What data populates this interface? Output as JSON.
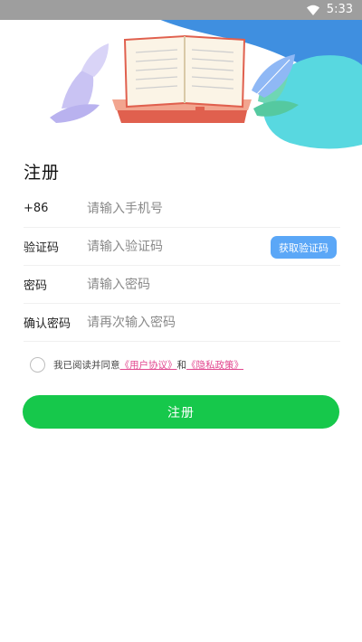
{
  "status_bar": {
    "time": "5:33",
    "icons": [
      "wifi-icon"
    ]
  },
  "page": {
    "title": "注册"
  },
  "form": {
    "phone": {
      "label": "+86",
      "placeholder": "请输入手机号"
    },
    "code": {
      "label": "验证码",
      "placeholder": "请输入验证码",
      "button": "获取验证码"
    },
    "password": {
      "label": "密码",
      "placeholder": "请输入密码"
    },
    "confirm": {
      "label": "确认密码",
      "placeholder": "请再次输入密码"
    }
  },
  "agreement": {
    "prefix": "我已阅读并同意",
    "user_agreement": "《用户协议》",
    "and": "和",
    "privacy_policy": "《隐私政策》",
    "checked": false
  },
  "submit": {
    "label": "注册"
  },
  "colors": {
    "status_bar": "#9e9e9e",
    "accent_blue": "#5ba7f7",
    "primary_green": "#16c84b",
    "link_pink": "#e2478f",
    "book_red": "#e0604e",
    "hero_blue": "#3f8fe0",
    "hero_cyan": "#58d8e0"
  }
}
